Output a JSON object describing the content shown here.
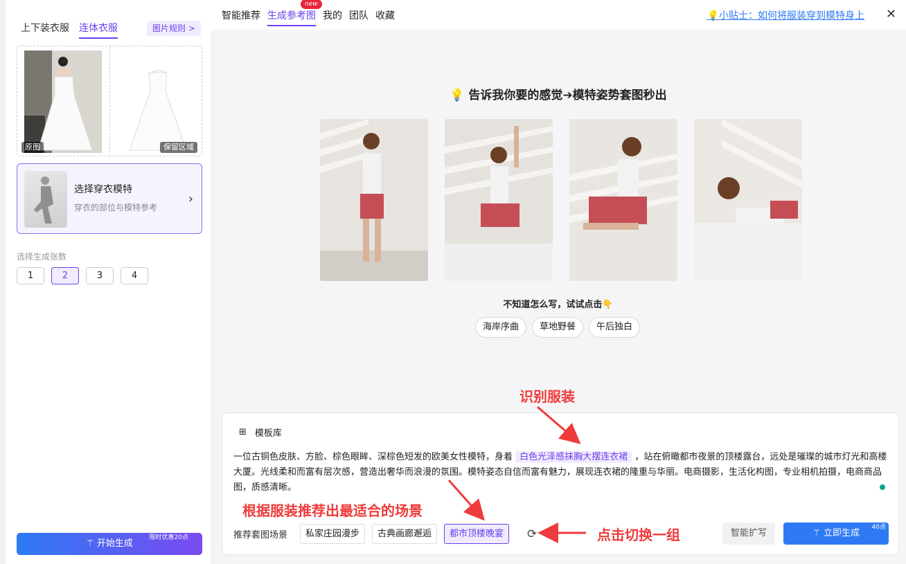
{
  "left": {
    "tabs": [
      "上下装衣服",
      "连体衣服"
    ],
    "rule_btn": "图片规则 >",
    "img_tags": [
      "原图",
      "保留区域"
    ],
    "model": {
      "title": "选择穿衣模特",
      "sub": "穿衣的部位与模特参考"
    },
    "count_label": "选择生成张数",
    "counts": [
      "1",
      "2",
      "3",
      "4"
    ],
    "start": {
      "label": "开始生成",
      "badge": "限时优惠20点"
    }
  },
  "right": {
    "tabs": [
      "智能推荐",
      "生成参考图",
      "我的",
      "团队",
      "收藏"
    ],
    "new_badge": "new",
    "tip": "💡小贴士：如何将服装穿到模特身上",
    "close": "✕",
    "headline": "💡 告诉我你要的感觉➔模特姿势套图秒出",
    "hint": "不知道怎么写，试试点击👇",
    "chips": [
      "海岸序曲",
      "草地野餐",
      "午后独白"
    ],
    "prompt": {
      "tpl_label": "模板库",
      "text_pre": "一位古铜色皮肤、方脸、棕色眼眸、深棕色短发的欧美女性模特，身着",
      "text_hl": "白色光泽感抹胸大摆连衣裙",
      "text_post": "，站在俯瞰都市夜景的顶楼露台，远处是璀璨的城市灯光和高楼大厦。光线柔和而富有层次感，营造出奢华而浪漫的氛围。模特姿态自信而富有魅力，展现连衣裙的隆重与华丽。电商摄影，生活化构图，专业相机拍摄，电商商品图，质感清晰。",
      "scene_label": "推荐套图场景",
      "scenes": [
        "私家庄园漫步",
        "古典画廊邂逅",
        "都市顶楼晚宴"
      ],
      "expand": "智能扩写",
      "gen": {
        "label": "立即生成",
        "badge": "40点"
      }
    }
  },
  "annotations": {
    "recognize": "识别服装",
    "recommend": "根据服装推荐出最适合的场景",
    "switch": "点击切换一组"
  },
  "colors": {
    "accent": "#6a3ff0",
    "blue": "#2e7af5",
    "annotation": "#ef3b3b"
  }
}
